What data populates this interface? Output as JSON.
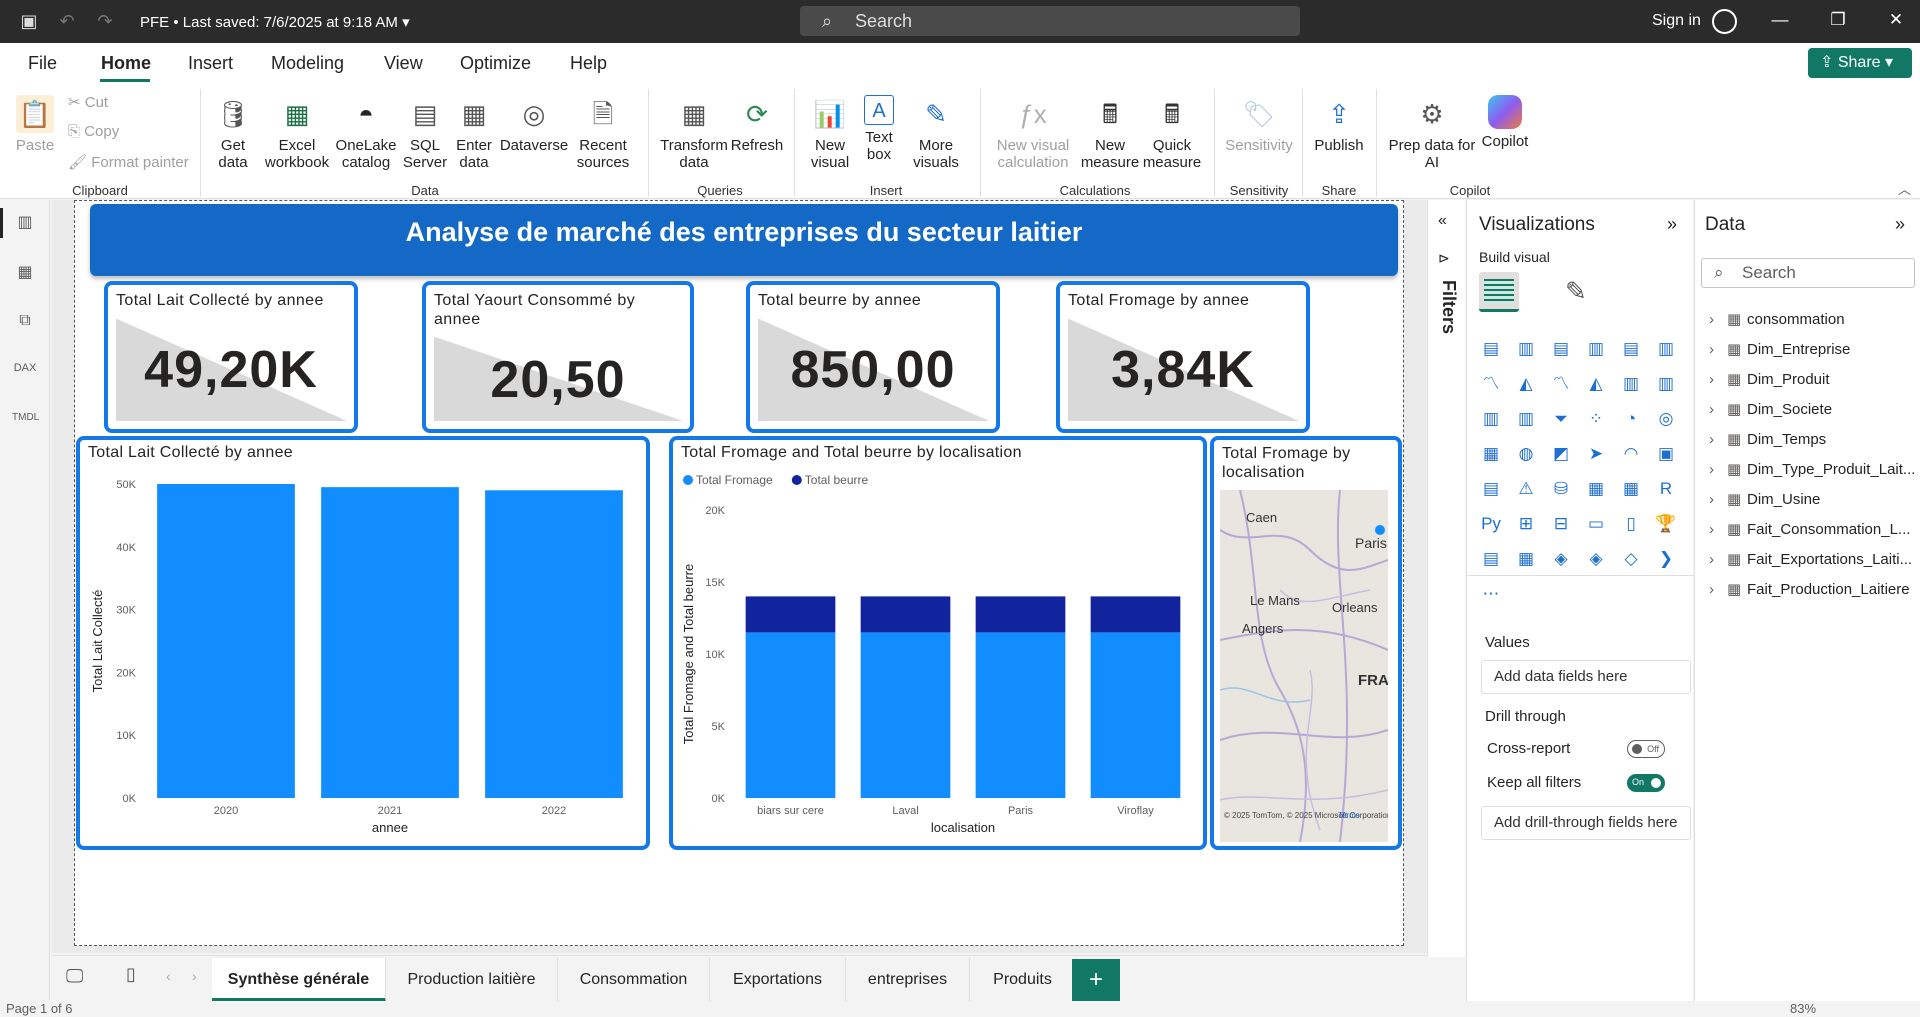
{
  "titlebar": {
    "doc_name": "PFE",
    "saved": "Last saved: 7/6/2025 at 9:18 AM",
    "search": "Search",
    "signin": "Sign in"
  },
  "menu": {
    "items": [
      "File",
      "Home",
      "Insert",
      "Modeling",
      "View",
      "Optimize",
      "Help"
    ],
    "active": "Home",
    "share": "Share"
  },
  "ribbon": {
    "clipboard": {
      "paste": "Paste",
      "cut": "Cut",
      "copy": "Copy",
      "format_painter": "Format painter",
      "group": "Clipboard"
    },
    "data": {
      "get_data": "Get data",
      "excel": "Excel workbook",
      "onelake": "OneLake catalog",
      "sql": "SQL Server",
      "enter": "Enter data",
      "dataverse": "Dataverse",
      "recent": "Recent sources",
      "group": "Data"
    },
    "queries": {
      "transform": "Transform data",
      "refresh": "Refresh",
      "group": "Queries"
    },
    "insert": {
      "new_visual": "New visual",
      "text_box": "Text box",
      "more_visuals": "More visuals",
      "group": "Insert"
    },
    "calculations": {
      "new_visual_calc": "New visual calculation",
      "new_measure": "New measure",
      "quick_measure": "Quick measure",
      "group": "Calculations"
    },
    "sensitivity": {
      "label": "Sensitivity",
      "group": "Sensitivity"
    },
    "share": {
      "publish": "Publish",
      "group": "Share"
    },
    "copilot": {
      "prep": "Prep data for AI",
      "copilot": "Copilot",
      "group": "Copilot"
    }
  },
  "report": {
    "banner": "Analyse de marché des entreprises du secteur laitier",
    "cards": [
      {
        "title": "Total Lait Collecté by annee",
        "value": "49,20K"
      },
      {
        "title": "Total Yaourt Consommé by annee",
        "value": "20,50"
      },
      {
        "title": "Total beurre by annee",
        "value": "850,00"
      },
      {
        "title": "Total Fromage by annee",
        "value": "3,84K"
      }
    ],
    "map": {
      "title": "Total Fromage by localisation",
      "cities": [
        "Caen",
        "Paris",
        "Le Mans",
        "Orleans",
        "Angers",
        "FRA"
      ],
      "attribution": "© 2025 TomTom, © 2025 Microsoft Corporation",
      "terms": "Terms"
    }
  },
  "chart_data": [
    {
      "type": "bar",
      "title": "Total Lait Collecté by annee",
      "xlabel": "annee",
      "ylabel": "Total Lait Collecté",
      "categories": [
        "2020",
        "2021",
        "2022"
      ],
      "values": [
        50000,
        49500,
        49000
      ],
      "ylim": [
        0,
        50000
      ],
      "yticks": [
        "0K",
        "10K",
        "20K",
        "30K",
        "40K",
        "50K"
      ],
      "color": "#118DFF"
    },
    {
      "type": "bar",
      "stacked": true,
      "title": "Total Fromage and Total beurre by localisation",
      "xlabel": "localisation",
      "ylabel": "Total Fromage and Total beurre",
      "categories": [
        "biars sur cere",
        "Laval",
        "Paris",
        "Viroflay"
      ],
      "series": [
        {
          "name": "Total Fromage",
          "values": [
            11500,
            11500,
            11500,
            11500
          ],
          "color": "#118DFF"
        },
        {
          "name": "Total beurre",
          "values": [
            2500,
            2500,
            2500,
            2500
          ],
          "color": "#12239E"
        }
      ],
      "ylim": [
        0,
        20000
      ],
      "yticks": [
        "0K",
        "5K",
        "10K",
        "15K",
        "20K"
      ],
      "legend": "top-left"
    }
  ],
  "filters": {
    "label": "Filters"
  },
  "visualizations": {
    "title": "Visualizations",
    "build": "Build visual",
    "values": "Values",
    "add_data": "Add data fields here",
    "drill": "Drill through",
    "cross": "Cross-report",
    "cross_state": "Off",
    "keep": "Keep all filters",
    "keep_state": "On",
    "add_drill": "Add drill-through fields here"
  },
  "data_pane": {
    "title": "Data",
    "search": "Search",
    "tables": [
      "consommation",
      "Dim_Entreprise",
      "Dim_Produit",
      "Dim_Societe",
      "Dim_Temps",
      "Dim_Type_Produit_Lait...",
      "Dim_Usine",
      "Fait_Consommation_L...",
      "Fait_Exportations_Laiti...",
      "Fait_Production_Laitiere"
    ]
  },
  "tabs": {
    "pages": [
      "Synthèse générale",
      "Production laitière",
      "Consommation",
      "Exportations",
      "entreprises",
      "Produits"
    ],
    "active": 0
  },
  "status": {
    "page": "Page 1 of 6",
    "zoom": "83%"
  }
}
